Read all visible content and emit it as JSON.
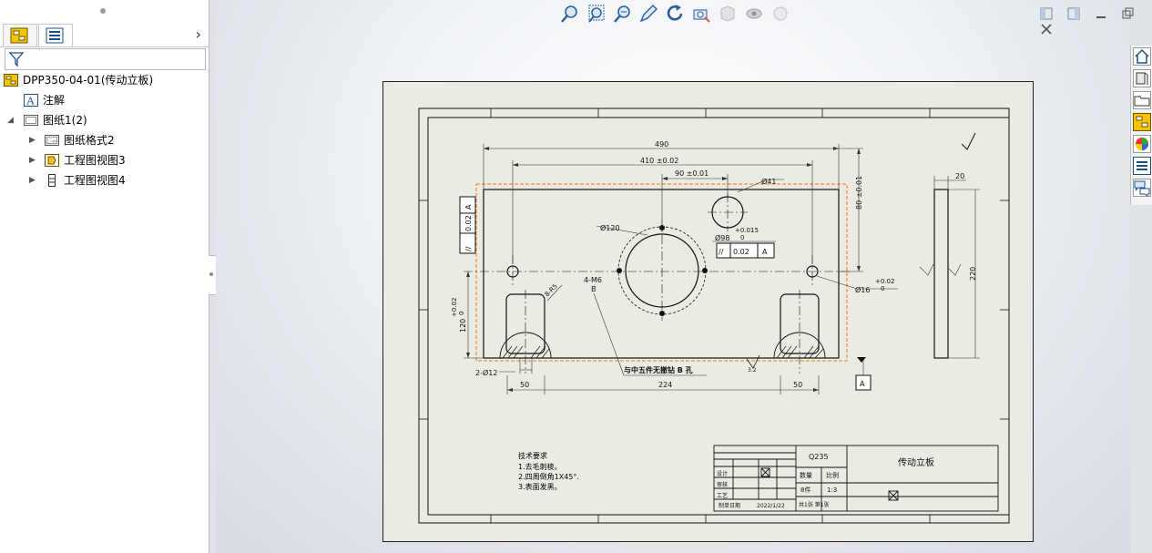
{
  "feature_tree": {
    "root_label": "DPP350-04-01(传动立板)",
    "items": [
      {
        "label": "注解"
      },
      {
        "label": "图纸1(2)"
      },
      {
        "label": "图纸格式2"
      },
      {
        "label": "工程图视图3"
      },
      {
        "label": "工程图视图4"
      }
    ]
  },
  "drawing": {
    "dims": {
      "d490": "490",
      "d410": "410 ±0.02",
      "d90": "90 ±0.01",
      "d80": "80 ±0.01",
      "d41": "Ø41",
      "d120": "Ø120",
      "d98": "Ø98",
      "tol_up": "+0.015",
      "tol_zero": "0",
      "gtol_sym": "//",
      "gtol_val": "0.02",
      "gtol_ref": "A",
      "holes4": "4-M6",
      "holes4b": "B",
      "d16": "Ø16",
      "tol16_up": "+0.02",
      "tol16_lo": "0",
      "d120v": "120",
      "tol120_up": "+0.02",
      "tol120_lo": "0",
      "d2x12": "2-Ø12",
      "d50a": "50",
      "d224": "224",
      "d50b": "50",
      "d20": "20",
      "d220": "220",
      "note_drill": "与中五件无撤钻 B 孔",
      "ra": "3.2",
      "datum": "A",
      "r6": "8-R5"
    },
    "tech_req": {
      "title": "技术要求",
      "lines": [
        "1.去毛刺棱。",
        "2.四周倒角1X45°.",
        "3.表面发黑。"
      ]
    },
    "title_block": {
      "material": "Q235",
      "part_name": "传动立板",
      "qty_label": "数量",
      "scale_label": "比例",
      "qty_value": "8件",
      "scale_value": "1:3",
      "sheet_info": "共1张 第1张",
      "date_label": "制单日期",
      "date_value": "2022/1/22",
      "row_labels": [
        "设计",
        "审核",
        "工艺"
      ]
    }
  }
}
